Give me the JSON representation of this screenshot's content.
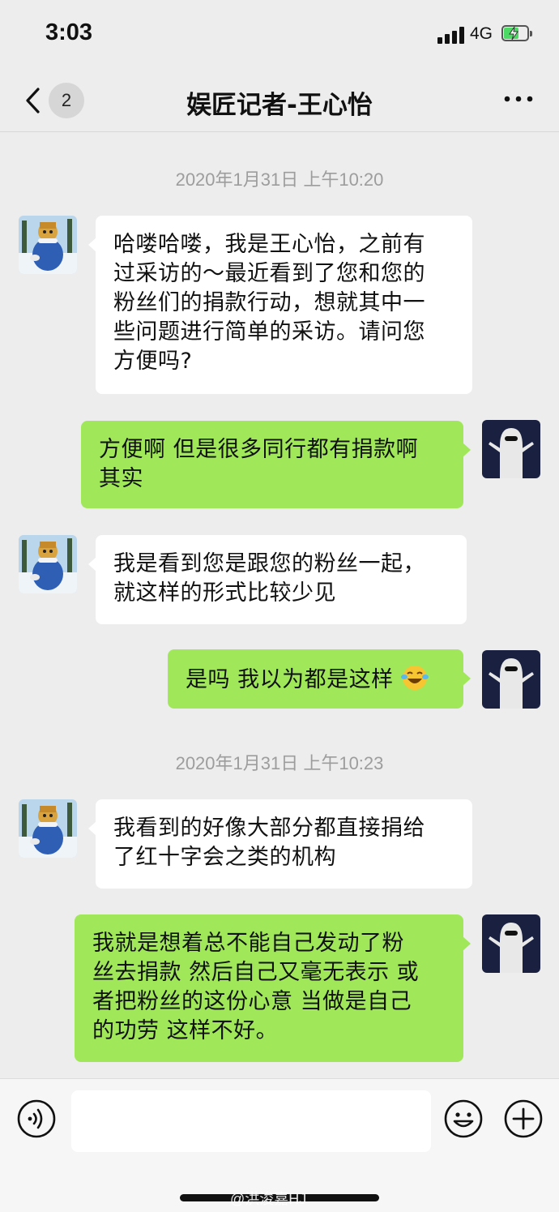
{
  "status_bar": {
    "time": "3:03",
    "network": "4G",
    "battery_color": "#4cd964"
  },
  "nav": {
    "back_icon": "chevron-left-icon",
    "unread_count": "2",
    "title": "娱匠记者-王心怡",
    "more_icon": "more-dots-icon"
  },
  "chat": {
    "timestamps": [
      "2020年1月31日 上午10:20",
      "2020年1月31日 上午10:23"
    ],
    "messages": [
      {
        "side": "left",
        "lines": [
          "哈喽哈喽，我是王心怡，之前有",
          "过采访的～最近看到了您和您的",
          "粉丝们的捐款行动，想就其中一",
          "些问题进行简单的采访。请问您",
          "方便吗?"
        ]
      },
      {
        "side": "right",
        "lines": [
          "方便啊 但是很多同行都有捐款啊",
          "其实"
        ]
      },
      {
        "side": "left",
        "lines": [
          "我是看到您是跟您的粉丝一起，",
          "就这样的形式比较少见"
        ]
      },
      {
        "side": "right",
        "lines": [
          "是吗 我以为都是这样"
        ],
        "emoji": "laughing-tears-emoji-icon"
      },
      {
        "side": "left",
        "lines": [
          "我看到的好像大部分都直接捐给",
          "了红十字会之类的机构"
        ]
      },
      {
        "side": "right",
        "lines": [
          "我就是想着总不能自己发动了粉",
          "丝去捐款 然后自己又毫无表示 或",
          "者把粉丝的这份心意 当做是自己",
          "的功劳 这样不好。"
        ]
      }
    ],
    "colors": {
      "sent_bubble": "#a0e75a",
      "received_bubble": "#ffffff",
      "background": "#ededed"
    }
  },
  "input_bar": {
    "voice_icon": "voice-icon",
    "emoji_icon": "emoji-icon",
    "plus_icon": "plus-icon",
    "text_value": ""
  },
  "watermark": "@洪浚嘉HJ"
}
